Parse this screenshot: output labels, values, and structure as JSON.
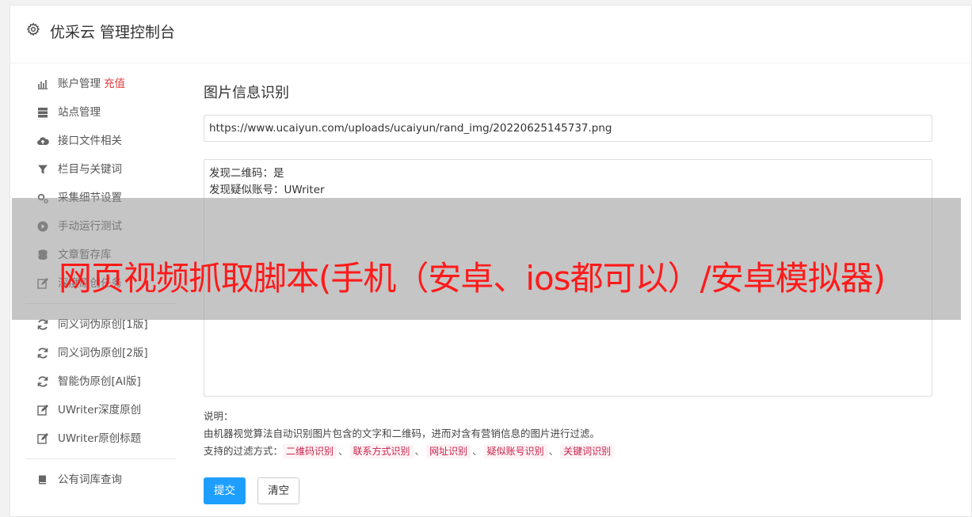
{
  "header": {
    "title": "优采云 管理控制台",
    "icon": "gear-icon"
  },
  "sidebar": {
    "group1": [
      {
        "label": "账户管理",
        "extra": "充值",
        "icon": "bar-chart-icon"
      },
      {
        "label": "站点管理",
        "icon": "server-icon"
      },
      {
        "label": "接口文件相关",
        "icon": "cloud-upload-icon"
      },
      {
        "label": "栏目与关键词",
        "icon": "filter-icon"
      },
      {
        "label": "采集细节设置",
        "icon": "gears-icon"
      },
      {
        "label": "手动运行测试",
        "icon": "play-circle-icon"
      },
      {
        "label": "文章暂存库",
        "icon": "database-icon"
      },
      {
        "label": "深度原创任务",
        "icon": "edit-icon"
      }
    ],
    "group2": [
      {
        "label": "同义词伪原创[1版]",
        "icon": "refresh-icon"
      },
      {
        "label": "同义词伪原创[2版]",
        "icon": "refresh-icon"
      },
      {
        "label": "智能伪原创[AI版]",
        "icon": "refresh-icon"
      },
      {
        "label": "UWriter深度原创",
        "icon": "edit-icon"
      },
      {
        "label": "UWriter原创标题",
        "icon": "edit-icon"
      }
    ],
    "group3": [
      {
        "label": "公有词库查询",
        "icon": "book-icon"
      }
    ]
  },
  "main": {
    "title": "图片信息识别",
    "url_value": "https://www.ucaiyun.com/uploads/ucaiyun/rand_img/20220625145737.png",
    "result_lines": [
      "发现二维码：是",
      "发现疑似账号：UWriter"
    ],
    "notes_label": "说明：",
    "notes_desc": "由机器视觉算法自动识别图片包含的文字和二维码，进而对含有营销信息的图片进行过滤。",
    "filter_label": "支持的过滤方式：",
    "filters": [
      "二维码识别",
      "联系方式识别",
      "网址识别",
      "疑似账号识别",
      "关键词识别"
    ],
    "separator": "、",
    "submit_label": "提交",
    "clear_label": "清空"
  },
  "overlay": {
    "text": "网页视频抓取脚本(手机（安卓、ios都可以）/安卓模拟器)"
  },
  "colors": {
    "accent": "#1e9fff",
    "recharge": "#e4393c",
    "overlay_text": "#ff1a1a",
    "tag_text": "#c7254e",
    "tag_bg": "#fdf2f4"
  }
}
